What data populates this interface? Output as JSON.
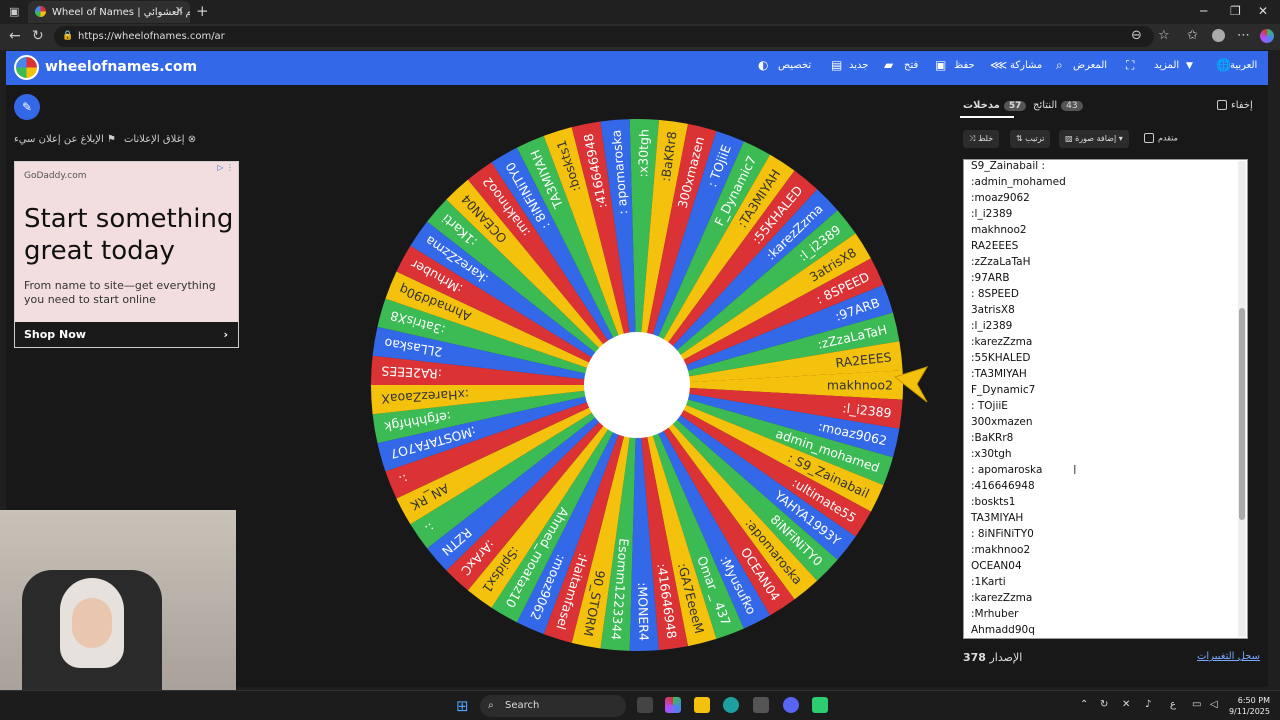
{
  "browser": {
    "tab_title": "Wheel of Names | الاسم العشوائي",
    "url": "https://wheelofnames.com/ar",
    "new_tab": "+",
    "tab_close": "✕"
  },
  "header": {
    "site_name": "wheelofnames.com",
    "nav": [
      {
        "label": "العربية",
        "icon": "globe-icon"
      },
      {
        "label": "المزيد",
        "icon": "chevron-down-icon"
      },
      {
        "label": "",
        "icon": "fullscreen-icon"
      },
      {
        "label": "المعرض",
        "icon": "search-icon"
      },
      {
        "label": "مشاركة",
        "icon": "share-icon"
      },
      {
        "label": "حفظ",
        "icon": "save-icon"
      },
      {
        "label": "فتح",
        "icon": "folder-icon"
      },
      {
        "label": "جديد",
        "icon": "new-file-icon"
      },
      {
        "label": "تخصيص",
        "icon": "palette-icon"
      }
    ]
  },
  "left": {
    "report_ad": "الإبلاغ عن إعلان سيء",
    "close_ads": "إغلاق الإعلانات"
  },
  "ad": {
    "domain": "GoDaddy.com",
    "headline": "Start something great today",
    "body": "From name to site—get everything you need to start online",
    "cta": "Shop Now"
  },
  "panel": {
    "hide": "إخفاء",
    "tab_results": "النتائج",
    "results_count": "43",
    "tab_entries": "مدخلات",
    "entries_count": "57",
    "shuffle": "خلط",
    "sort": "ترتيب",
    "add_image": "إضافة صورة",
    "advanced": "متقدم",
    "version_label": "الإصدار",
    "version": "378",
    "changelog": "سجل التغييرات"
  },
  "entries": [
    "S9_Zainabail :",
    ":admin_mohamed",
    ":moaz9062",
    ":l_i2389",
    "makhnoo2",
    "RA2EEES",
    ":zZzaLaTaH",
    ":97ARB",
    ": 8SPEED",
    "3atrisX8",
    ":l_i2389",
    ":karezZzma",
    ":55KHALED",
    ":TA3MIYAH",
    "F_Dynamic7",
    ": TOjiiE",
    "300xmazen",
    ":BaKRr8",
    ":x30tgh",
    ": apomaroska",
    ":416646948",
    ":boskts1",
    "TA3MIYAH",
    ": 8iNFiNiTY0",
    ":makhnoo2",
    "OCEAN04",
    ":1Karti",
    ":karezZzma",
    ":Mrhuber",
    "Ahmadd90q"
  ],
  "wheel_labels": [
    "makhnoo2",
    ":l_i2389",
    ":moaz9062",
    "admin_mohamed",
    ": S9_Zainabail",
    ":ultimate55",
    "YAHYA1993Y",
    "8iNFiNiTY0",
    ":apomaroska",
    "OCEAN04",
    ":Myusufko",
    "Omar _ 437",
    ":GA7EeeeM",
    ":416646948",
    ":MONER4",
    "Esomm1223344",
    "90_STORM",
    ":Haitamfasel",
    ":moaz9062",
    "Ahmed_moataz10",
    ":Spidsx1",
    ":ArAxC",
    "RZTN",
    ":.",
    "AN_RK",
    ":.",
    ":MOSTAFA7O7",
    ":efghhhfgk",
    ":xHarezZaoaX",
    ":RA2EEES",
    "2LLaskao",
    ":3atrisX8",
    "Ahmadd90q",
    ":Mrhuber",
    ":karezZzma",
    ":1Karti",
    "OCEAN04",
    ":makhnoo2",
    ": 8iNFiNiTY0",
    "TA3MIYAH",
    ":boskts1",
    ":416646948",
    ": apomaroska",
    ":x30tgh",
    ":BaKRr8",
    "300xmazen",
    ": TOjiiE",
    "F_Dynamic7",
    ":TA3MIYAH",
    ":55KHALED",
    ":karezZzma",
    ":l_i2389",
    "3atrisX8",
    ": 8SPEED",
    ":97ARB",
    ":zZzaLaTaH",
    "RA2EEES"
  ],
  "wheel_colors": [
    "#f4c20d",
    "#db3236",
    "#3369e8",
    "#3cba54"
  ],
  "taskbar": {
    "search": "Search",
    "time": "6:50 PM",
    "date": "9/11/2025",
    "lang": "ع"
  }
}
